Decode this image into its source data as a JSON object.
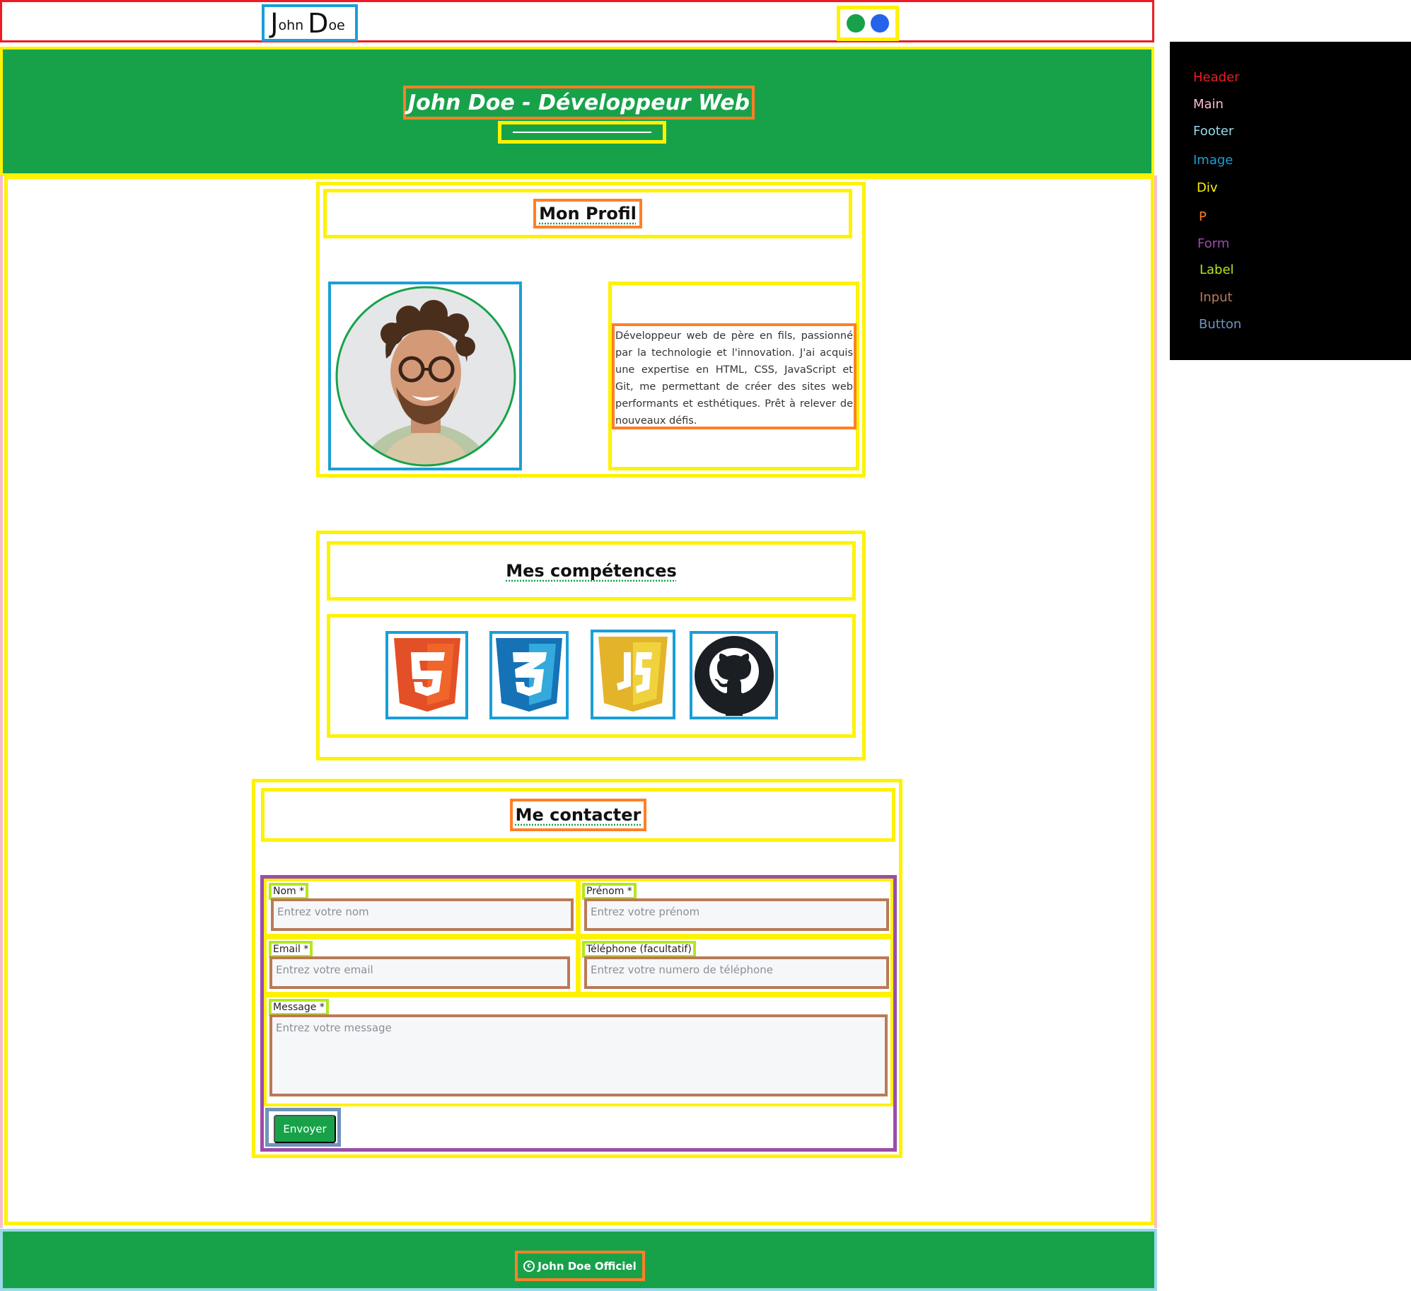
{
  "header": {
    "logo": {
      "first_initial": "J",
      "first_rest": "ohn",
      "last_initial": "D",
      "last_rest": "oe"
    },
    "theme_dots": [
      {
        "name": "green-theme-dot",
        "color": "#17a24a"
      },
      {
        "name": "blue-theme-dot",
        "color": "#2563eb"
      }
    ]
  },
  "banner": {
    "title": "John Doe - Développeur Web"
  },
  "profile": {
    "heading": "Mon Profil",
    "bio": "Développeur web de père en fils, passionné par la technologie et l'innovation. J'ai acquis une expertise en HTML, CSS, JavaScript et Git, me permettant de créer des sites web performants et esthétiques. Prêt à relever de nouveaux défis."
  },
  "skills": {
    "heading": "Mes compétences",
    "items": [
      "html5-logo",
      "css3-logo",
      "javascript-logo",
      "github-logo"
    ]
  },
  "contact": {
    "heading": "Me contacter",
    "fields": {
      "nom_label": "Nom *",
      "nom_placeholder": "Entrez votre nom",
      "prenom_label": "Prénom *",
      "prenom_placeholder": "Entrez votre prénom",
      "email_label": "Email *",
      "email_placeholder": "Entrez votre email",
      "tel_label": "Téléphone (facultatif)",
      "tel_placeholder": "Entrez votre numero de téléphone",
      "message_label": "Message *",
      "message_placeholder": "Entrez votre message"
    },
    "submit_label": "Envoyer"
  },
  "footer": {
    "copyright_symbol": "c",
    "text": "John Doe Officiel"
  },
  "legend": {
    "items": [
      {
        "label": "Header",
        "color": "#ed1c24"
      },
      {
        "label": "Main",
        "color": "#f8bcd0"
      },
      {
        "label": "Footer",
        "color": "#99d9ea"
      },
      {
        "label": "Image",
        "color": "#1a9fd8"
      },
      {
        "label": "Div",
        "color": "#fff200"
      },
      {
        "label": "P",
        "color": "#ff7f27"
      },
      {
        "label": "Form",
        "color": "#9b4dab"
      },
      {
        "label": "Label",
        "color": "#b5e61d"
      },
      {
        "label": "Input",
        "color": "#b97a57"
      },
      {
        "label": "Button",
        "color": "#7092be"
      }
    ]
  },
  "colors": {
    "brand_green": "#17a24a",
    "header_outline": "#ed1c24",
    "div_outline": "#fff200"
  }
}
